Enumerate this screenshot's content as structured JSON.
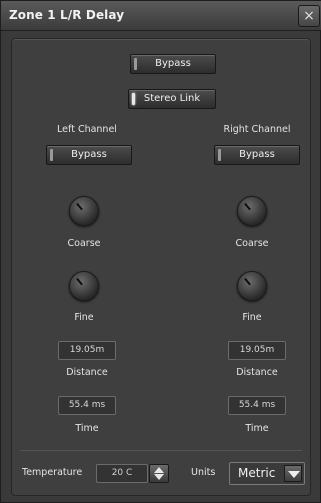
{
  "window": {
    "title": "Zone 1 L/R Delay",
    "close_glyph": "×"
  },
  "top": {
    "bypass_label": "Bypass",
    "stereo_link_label": "Stereo Link"
  },
  "left": {
    "heading": "Left Channel",
    "bypass_label": "Bypass",
    "coarse_label": "Coarse",
    "fine_label": "Fine",
    "distance_value": "19.05m",
    "distance_label": "Distance",
    "time_value": "55.4 ms",
    "time_label": "Time"
  },
  "right": {
    "heading": "Right Channel",
    "bypass_label": "Bypass",
    "coarse_label": "Coarse",
    "fine_label": "Fine",
    "distance_value": "19.05m",
    "distance_label": "Distance",
    "time_value": "55.4 ms",
    "time_label": "Time"
  },
  "footer": {
    "temperature_label": "Temperature",
    "temperature_value": "20 C",
    "units_label": "Units",
    "units_value": "Metric"
  }
}
